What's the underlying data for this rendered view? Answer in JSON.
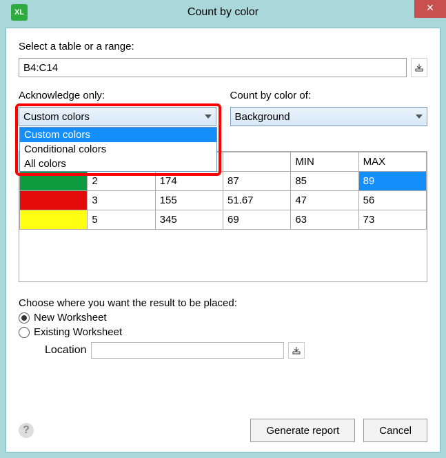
{
  "title": "Count by color",
  "xl_badge": "XL",
  "close_glyph": "✕",
  "range": {
    "label": "Select a table or a range:",
    "value": "B4:C14"
  },
  "ack": {
    "label": "Acknowledge only:",
    "selected": "Custom colors",
    "options": [
      "Custom colors",
      "Conditional colors",
      "All colors"
    ]
  },
  "colorof": {
    "label": "Count by color of:",
    "selected": "Background"
  },
  "table": {
    "headers": [
      "",
      "",
      "",
      "",
      "MIN",
      "MAX"
    ],
    "rows": [
      {
        "color": "#0e9a3e",
        "cells": [
          "2",
          "174",
          "87",
          "85",
          "89"
        ],
        "selectedCol": 4
      },
      {
        "color": "#e40b0b",
        "cells": [
          "3",
          "155",
          "51.67",
          "47",
          "56"
        ]
      },
      {
        "color": "#ffff11",
        "cells": [
          "5",
          "345",
          "69",
          "63",
          "73"
        ]
      }
    ]
  },
  "placement": {
    "label": "Choose where you want the result to be placed:",
    "new_ws": "New Worksheet",
    "existing_ws": "Existing Worksheet",
    "location_label": "Location"
  },
  "buttons": {
    "generate": "Generate report",
    "cancel": "Cancel"
  }
}
